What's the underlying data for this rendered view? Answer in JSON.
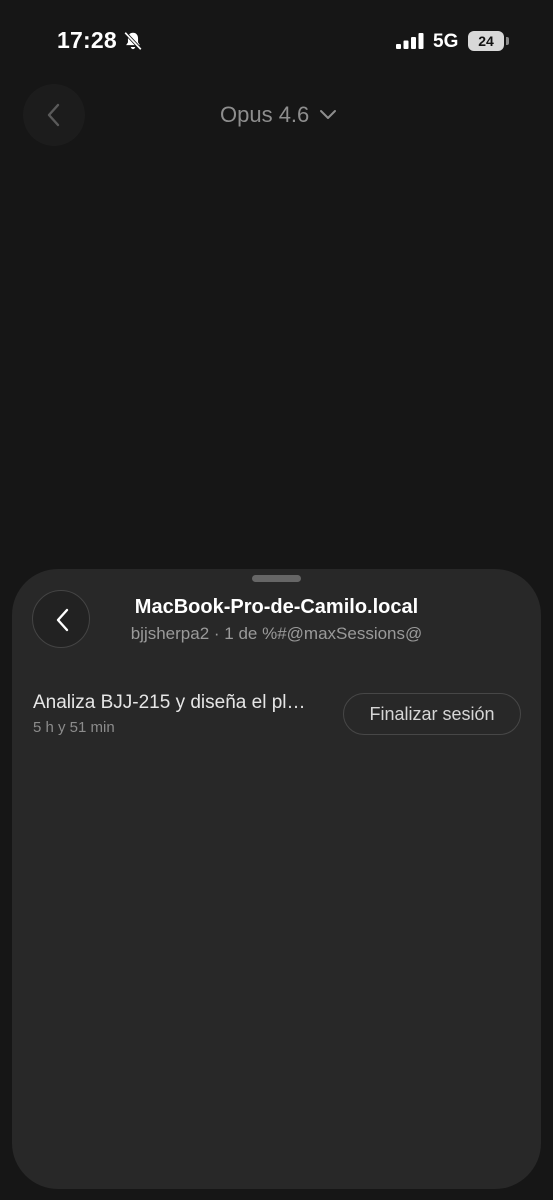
{
  "status_bar": {
    "time": "17:28",
    "network": "5G",
    "battery": "24",
    "icons": [
      "bell-slash-icon",
      "signal-bars-icon",
      "battery-icon"
    ]
  },
  "header": {
    "back_icon": "chevron-left-icon",
    "model_name": "Opus 4.6",
    "model_dropdown_icon": "chevron-down-icon"
  },
  "sheet": {
    "back_icon": "chevron-left-icon",
    "host_title": "MacBook-Pro-de-Camilo.local",
    "host_subtitle": "bjjsherpa2 · 1 de %#@maxSessions@",
    "sessions": [
      {
        "title": "Analiza BJJ-215 y diseña el pl…",
        "duration": "5 h y 51 min",
        "action_label": "Finalizar sesión"
      }
    ]
  },
  "colors": {
    "background": "#161616",
    "sheet": "#282828",
    "text_primary": "#ffffff",
    "text_secondary": "#9a9a9a"
  }
}
